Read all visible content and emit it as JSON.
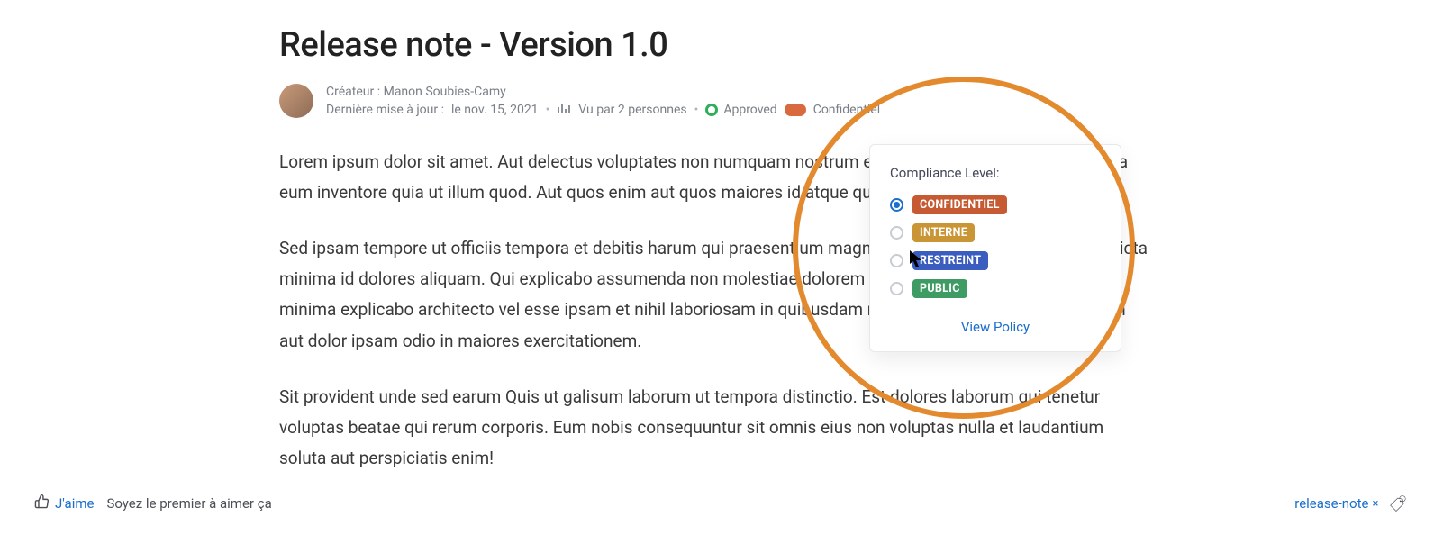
{
  "page": {
    "title": "Release note - Version 1.0"
  },
  "meta": {
    "creator_label": "Créateur :",
    "creator_name": "Manon Soubies-Camy",
    "updated_label": "Dernière mise à jour :",
    "updated_value": "le nov. 15, 2021",
    "views_text": "Vu par 2 personnes",
    "approved_label": "Approved",
    "confidential_label": "Confidentiel"
  },
  "body": {
    "p1": "Lorem ipsum dolor sit amet. Aut delectus voluptates non numquam nostrum ea omnis quia. In unde assumenda eum inventore quia ut illum quod. Aut quos enim aut quos maiores id atque quia.",
    "p2": "Sed ipsam tempore ut officiis tempora et debitis harum qui praesentium magni. Aut ipsam sunt aut illo iure et dicta minima id dolores aliquam. Qui explicabo assumenda non molestiae dolorem eum explicabo voluptas ut fugiat minima explicabo architecto vel esse ipsam et nihil laboriosam in quibusdam reprehenderit aut dolorem quidem aut dolor ipsam odio in maiores exercitationem.",
    "p3": "Sit provident unde sed earum Quis ut galisum laborum ut tempora distinctio. Est dolores laborum qui tenetur voluptas beatae qui rerum corporis. Eum nobis consequuntur sit omnis eius non voluptas nulla et laudantium soluta aut perspiciatis enim!"
  },
  "popover": {
    "title": "Compliance Level:",
    "levels": [
      {
        "label": "CONFIDENTIEL",
        "cls": "c-confidentiel",
        "checked": true
      },
      {
        "label": "INTERNE",
        "cls": "c-interne",
        "checked": false
      },
      {
        "label": "RESTREINT",
        "cls": "c-restreint",
        "checked": false
      },
      {
        "label": "PUBLIC",
        "cls": "c-public",
        "checked": false
      }
    ],
    "view_policy": "View Policy"
  },
  "footer": {
    "like_label": "J'aime",
    "like_hint": "Soyez le premier à aimer ça",
    "tag": "release-note"
  }
}
